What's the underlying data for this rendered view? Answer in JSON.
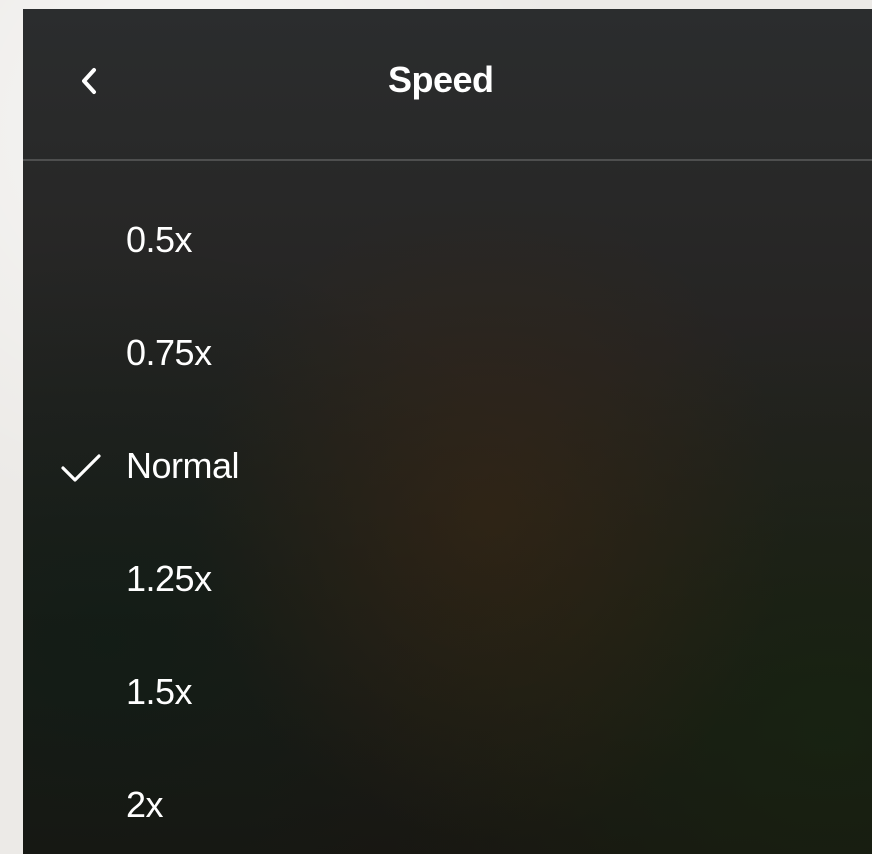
{
  "header": {
    "title": "Speed",
    "back_icon": "chevron-left-icon"
  },
  "speed_menu": {
    "selected": "Normal",
    "check_icon": "checkmark-icon",
    "options": [
      {
        "label": "0.5x",
        "selected": false
      },
      {
        "label": "0.75x",
        "selected": false
      },
      {
        "label": "Normal",
        "selected": true
      },
      {
        "label": "1.25x",
        "selected": false
      },
      {
        "label": "1.5x",
        "selected": false
      },
      {
        "label": "2x",
        "selected": false
      }
    ]
  },
  "colors": {
    "panel_bg": "#262524",
    "text": "#ffffff",
    "page_bg": "#eceae7"
  }
}
